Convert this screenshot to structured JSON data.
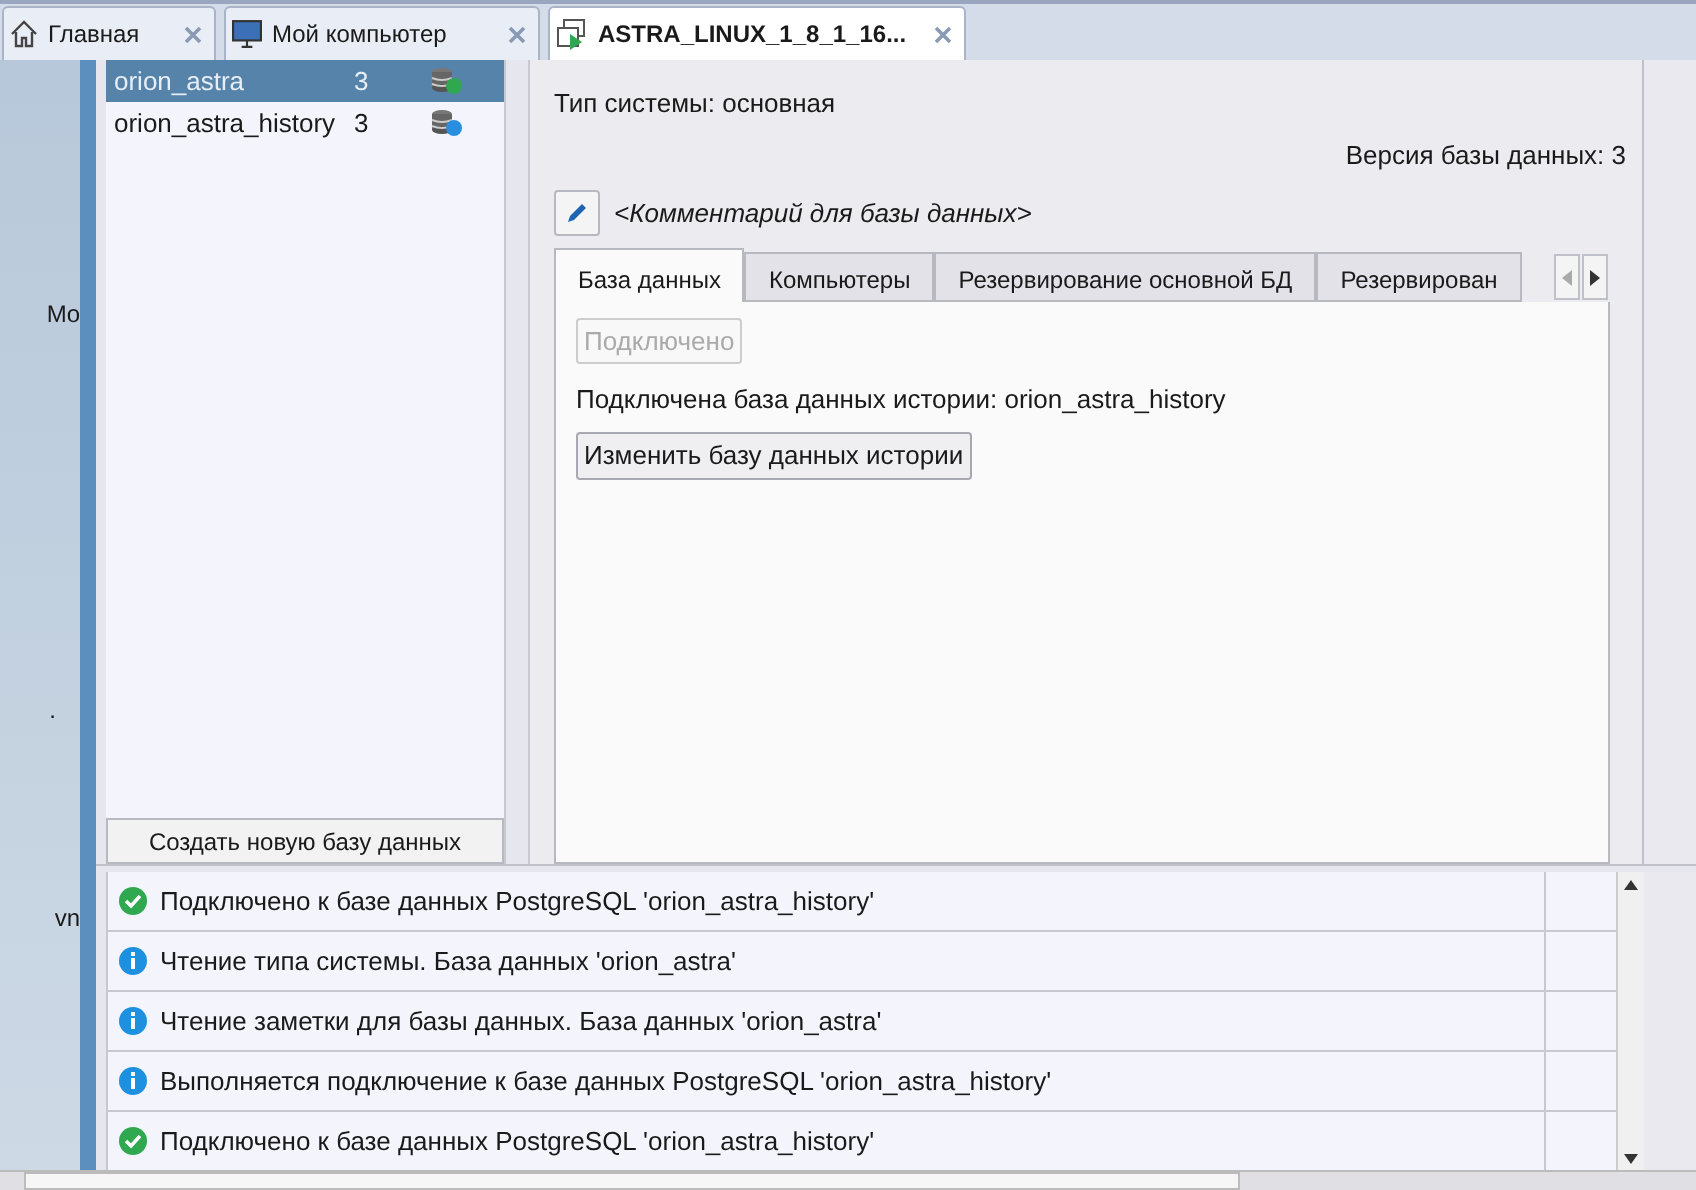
{
  "browser_tabs": [
    {
      "label": "Главная",
      "selected": false
    },
    {
      "label": "Мой компьютер",
      "selected": false
    },
    {
      "label": "ASTRA_LINUX_1_8_1_16...",
      "selected": true
    }
  ],
  "desktop_labels": [
    "Mo",
    ".",
    "vn"
  ],
  "databases": [
    {
      "name": "orion_astra",
      "version": "3",
      "kind": "primary",
      "selected": true
    },
    {
      "name": "orion_astra_history",
      "version": "3",
      "kind": "history",
      "selected": false
    }
  ],
  "create_button": "Создать новую базу данных",
  "details": {
    "system_type": "Тип системы: основная",
    "db_version": "Версия базы данных: 3",
    "comment": "<Комментарий для базы данных>",
    "tabs": [
      {
        "label": "База данных",
        "selected": true
      },
      {
        "label": "Компьютеры",
        "selected": false
      },
      {
        "label": "Резервирование основной БД",
        "selected": false
      },
      {
        "label": "Резервирован",
        "selected": false
      }
    ],
    "connected_button": {
      "label": "Подключено",
      "disabled": true
    },
    "history_text": "Подключена база данных истории: orion_astra_history",
    "change_button": "Изменить базу данных истории"
  },
  "log": [
    {
      "kind": "success",
      "message": "Подключено к базе данных PostgreSQL 'orion_astra_history'"
    },
    {
      "kind": "info",
      "message": "Чтение типа системы. База данных 'orion_astra'"
    },
    {
      "kind": "info",
      "message": "Чтение заметки для базы данных. База данных 'orion_astra'"
    },
    {
      "kind": "info",
      "message": "Выполняется подключение к базе данных PostgreSQL 'orion_astra_history'"
    },
    {
      "kind": "success",
      "message": "Подключено к базе данных PostgreSQL 'orion_astra_history'"
    }
  ]
}
